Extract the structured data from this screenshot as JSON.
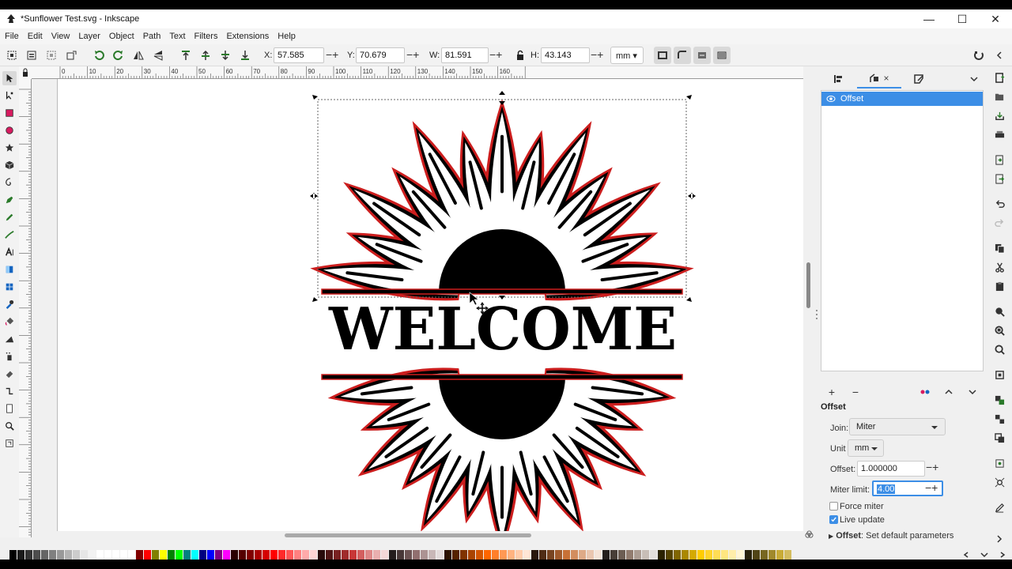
{
  "window": {
    "title": "*Sunflower Test.svg - Inkscape",
    "min_glyph": "—",
    "max_glyph": "☐",
    "close_glyph": "✕"
  },
  "menu": [
    "File",
    "Edit",
    "View",
    "Layer",
    "Object",
    "Path",
    "Text",
    "Filters",
    "Extensions",
    "Help"
  ],
  "tool_controls": {
    "x_label": "X:",
    "x_value": "57.585",
    "y_label": "Y:",
    "y_value": "70.679",
    "w_label": "W:",
    "w_value": "81.591",
    "h_label": "H:",
    "h_value": "43.143",
    "unit": "mm"
  },
  "ruler_top": [
    "0",
    "10",
    "20",
    "30",
    "40",
    "50",
    "60",
    "70",
    "80",
    "90",
    "100",
    "110",
    "120",
    "130",
    "140",
    "150",
    "160"
  ],
  "ruler_left": [
    "1",
    "0",
    "2",
    "0",
    "3",
    "0",
    "4",
    "0",
    "5",
    "0",
    "6",
    "0",
    "7",
    "0",
    "8",
    "0",
    "9",
    "0",
    "10",
    "0"
  ],
  "canvas": {
    "welcome_text": "WELCOME"
  },
  "dock": {
    "objects_tab_close": "×",
    "objects": [
      {
        "label": "Offset"
      }
    ],
    "section_title": "Offset",
    "join_label": "Join:",
    "join_value": "Miter",
    "unit_label": "Unit",
    "unit_value": "mm",
    "offset_label": "Offset:",
    "offset_value": "1.000000",
    "miter_label": "Miter limit:",
    "miter_value": "4.00",
    "force_miter_label": "Force miter",
    "force_miter_checked": false,
    "live_update_label": "Live update",
    "live_update_checked": true,
    "footer_bold": "Offset",
    "footer_text": ": Set default parameters"
  },
  "colors": {
    "accent": "#3c8ee6",
    "outline": "#cc1e1e"
  },
  "palette": [
    "#000000",
    "#1a1a1a",
    "#333333",
    "#4d4d4d",
    "#666666",
    "#808080",
    "#999999",
    "#b3b3b3",
    "#cccccc",
    "#e6e6e6",
    "#f2f2f2",
    "#ffffff",
    "#ffffff",
    "#ffffff",
    "#ffffff",
    "#ffffff",
    "#800000",
    "#ff0000",
    "#808000",
    "#ffff00",
    "#008000",
    "#00ff00",
    "#008080",
    "#00ffff",
    "#000080",
    "#0000ff",
    "#800080",
    "#ff00ff",
    "#2b0000",
    "#550000",
    "#800000",
    "#aa0000",
    "#d40000",
    "#ff0000",
    "#ff2a2a",
    "#ff5555",
    "#ff8080",
    "#ffaaaa",
    "#ffd5d5",
    "#280b0b",
    "#501616",
    "#782121",
    "#a02c2c",
    "#c83737",
    "#d35f5f",
    "#de8787",
    "#e9afaf",
    "#f4d7d7",
    "#241c1c",
    "#483737",
    "#6c5353",
    "#916f6f",
    "#ac9393",
    "#c8b7b7",
    "#e3dbdb",
    "#2b1100",
    "#552200",
    "#803300",
    "#aa4400",
    "#d45500",
    "#ff6600",
    "#ff7f2a",
    "#ff9955",
    "#ffb380",
    "#ffccaa",
    "#ffe6d5",
    "#28170b",
    "#502d16",
    "#784421",
    "#a05a2c",
    "#c87137",
    "#d38d5f",
    "#deaa87",
    "#e9c6af",
    "#f4e3d7",
    "#241f1c",
    "#483e37",
    "#6c5d53",
    "#917c6f",
    "#ac9d93",
    "#c8beb7",
    "#e3dedb",
    "#2b2200",
    "#554400",
    "#806600",
    "#aa8800",
    "#d4aa00",
    "#ffcc00",
    "#ffd42a",
    "#ffdd55",
    "#ffe680",
    "#ffeeaa",
    "#fff6d5",
    "#28220b",
    "#504416",
    "#786721",
    "#a0892c",
    "#c8ab37",
    "#d3bc5f"
  ]
}
